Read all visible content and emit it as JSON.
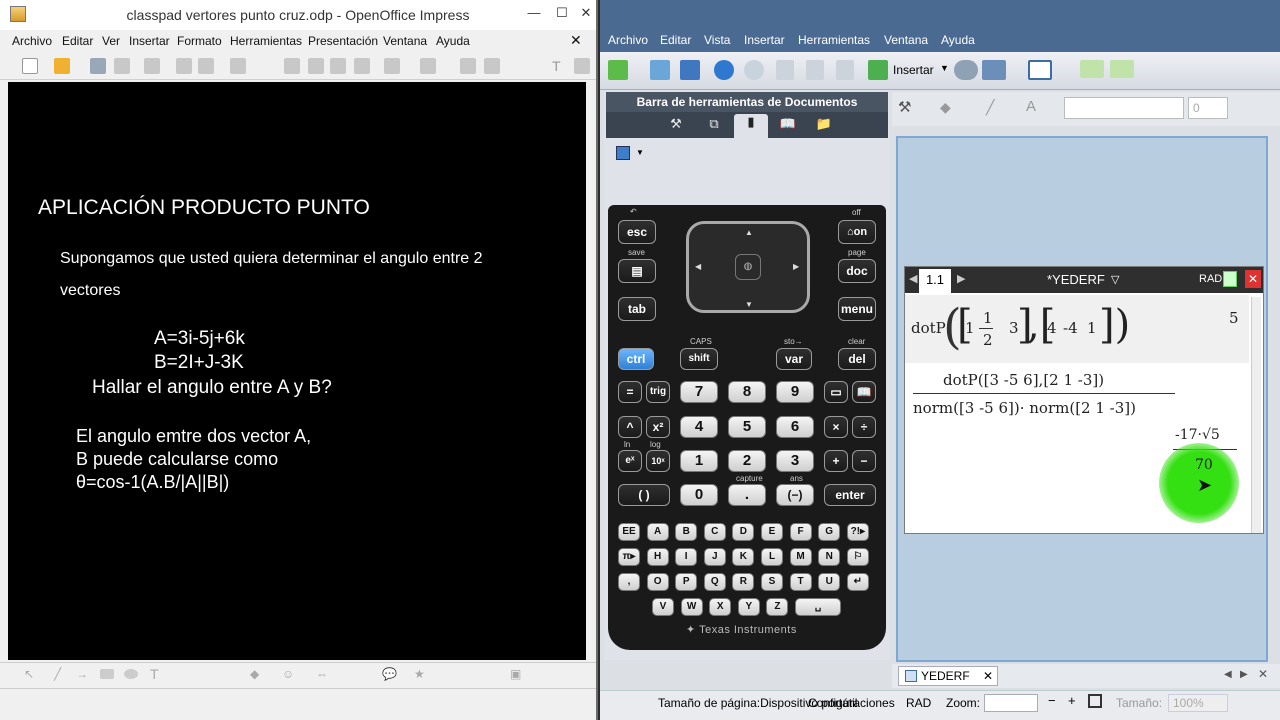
{
  "impress": {
    "title": "classpad vertores punto cruz.odp - OpenOffice Impress",
    "menus": [
      "Archivo",
      "Editar",
      "Ver",
      "Insertar",
      "Formato",
      "Herramientas",
      "Presentación",
      "Ventana",
      "Ayuda"
    ],
    "slide": {
      "heading": "APLICACIÓN PRODUCTO PUNTO",
      "para_line1": "Supongamos que usted quiera determinar el angulo entre 2",
      "para_line2": "vectores",
      "vec_a": "A=3i-5j+6k",
      "vec_b": "B=2I+J-3K",
      "question": "Hallar el angulo entre A y B?",
      "note_line1": "El angulo emtre dos vector A,",
      "note_line2": "B puede calcularse como",
      "note_line3": "θ=cos-1(A.B/|A||B|)"
    }
  },
  "nspire": {
    "menus": [
      "Archivo",
      "Editar",
      "Vista",
      "Insertar",
      "Herramientas",
      "Ventana",
      "Ayuda"
    ],
    "toolbar": {
      "insert_label": "Insertar",
      "font_size": "0"
    },
    "panel_title": "Barra de herramientas de Documentos",
    "handheld": {
      "brand": "Texas Instruments",
      "keys": {
        "esc": "esc",
        "on": "on",
        "doc": "doc",
        "tab": "tab",
        "menu": "menu",
        "ctrl": "ctrl",
        "shift": "shift",
        "var": "var",
        "del": "del",
        "eq": "=",
        "trig": "trig",
        "seven": "7",
        "eight": "8",
        "nine": "9",
        "caret": "^",
        "x2": "x²",
        "four": "4",
        "five": "5",
        "six": "6",
        "times": "×",
        "div": "÷",
        "ex": "eˣ",
        "ten": "10ˣ",
        "one": "1",
        "two": "2",
        "three": "3",
        "plus": "+",
        "minus": "−",
        "paren": "( )",
        "zero": "0",
        "dot": ".",
        "neg": "(−)",
        "enter": "enter"
      },
      "labels": {
        "off": "off",
        "save": "save",
        "page": "page",
        "caps": "CAPS",
        "sto": "sto→",
        "clear": "clear",
        "capture": "capture",
        "ans": "ans",
        "in": "ln",
        "log": "log"
      },
      "alpha_rows": [
        [
          "EE",
          "A",
          "B",
          "C",
          "D",
          "E",
          "F",
          "G",
          "?!▸"
        ],
        [
          "π▸",
          "H",
          "I",
          "J",
          "K",
          "L",
          "M",
          "N",
          "⚐"
        ],
        [
          ",",
          "O",
          "P",
          "Q",
          "R",
          "S",
          "T",
          "U",
          "↵"
        ],
        [
          "V",
          "W",
          "X",
          "Y",
          "Z",
          "␣"
        ]
      ]
    },
    "calc": {
      "page_tab": "1.1",
      "doc_name": "*YEDERF",
      "mode": "RAD",
      "entry1": "dotP",
      "result1": "5",
      "row1_vec1": [
        "1",
        "1",
        "2",
        "3"
      ],
      "row1_vec2": [
        "4",
        "-4",
        "1"
      ],
      "num_text": "dotP([3  -5  6],[2  1  -3])",
      "den_text": "norm([3  -5  6])· norm([2  1  -3])",
      "res_num": "-17·√5",
      "res_den": "70"
    },
    "tab_name": "YEDERF",
    "status": {
      "page_size": "Tamaño de página:Dispositivo portátil",
      "settings": "Configuraciones",
      "angle": "RAD",
      "zoom_label": "Zoom:",
      "size_label": "Tamaño:",
      "size_value": "100%"
    }
  }
}
